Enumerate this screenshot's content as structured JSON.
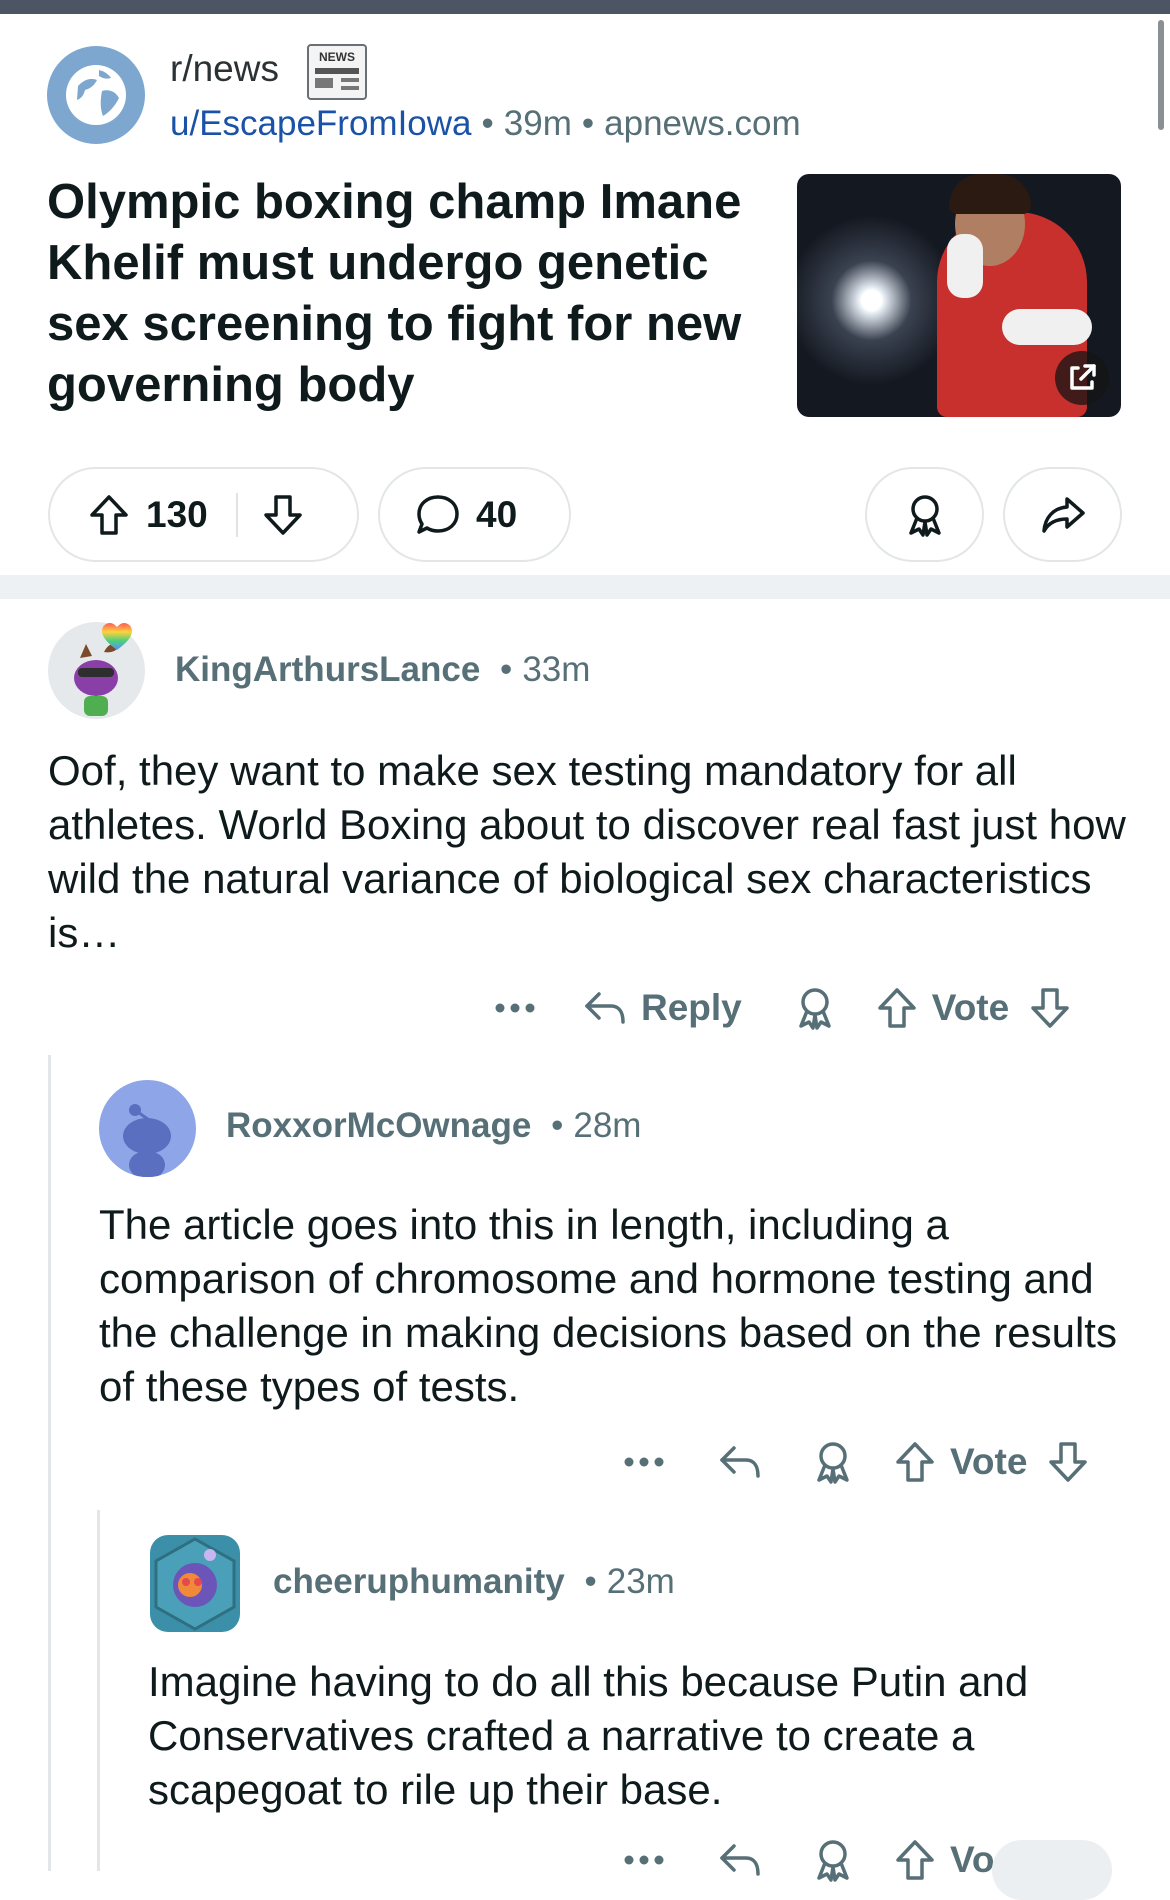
{
  "post": {
    "subreddit": "r/news",
    "badge_text": "NEWS",
    "author": "u/EscapeFromIowa",
    "age": "39m",
    "domain": "apnews.com",
    "title": "Olympic boxing champ Imane Khelif must undergo genetic sex screening to fight for new governing body",
    "upvotes": "130",
    "comments": "40",
    "icons": {
      "upvote": "arrow-up-icon",
      "downvote": "arrow-down-icon",
      "comments": "speech-bubble-icon",
      "award": "award-ribbon-icon",
      "share": "share-arrow-icon",
      "external": "external-link-icon"
    }
  },
  "comments": [
    {
      "user": "KingArthursLance",
      "time": "33m",
      "body": "Oof, they want to make sex testing mandatory for all athletes. World Boxing about to discover real fast just how wild the natural variance of biological sex characteristics is…",
      "actions": {
        "reply": "Reply",
        "vote": "Vote"
      }
    },
    {
      "user": "RoxxorMcOwnage",
      "time": "28m",
      "body": "The article goes into this in length, including a comparison of chromosome and hormone testing and the challenge in making decisions based on the results of these types of tests.",
      "actions": {
        "vote": "Vote"
      }
    },
    {
      "user": "cheeruphumanity",
      "time": "23m",
      "body": "Imagine having to do all this because Putin and Conservatives crafted a narrative to create a scapegoat to rile up their base.",
      "actions": {
        "vote": "Vo"
      }
    }
  ],
  "colors": {
    "text": "#0f1a1c",
    "meta": "#576f76",
    "link": "#1a52a8",
    "divider": "#eef1f3"
  }
}
